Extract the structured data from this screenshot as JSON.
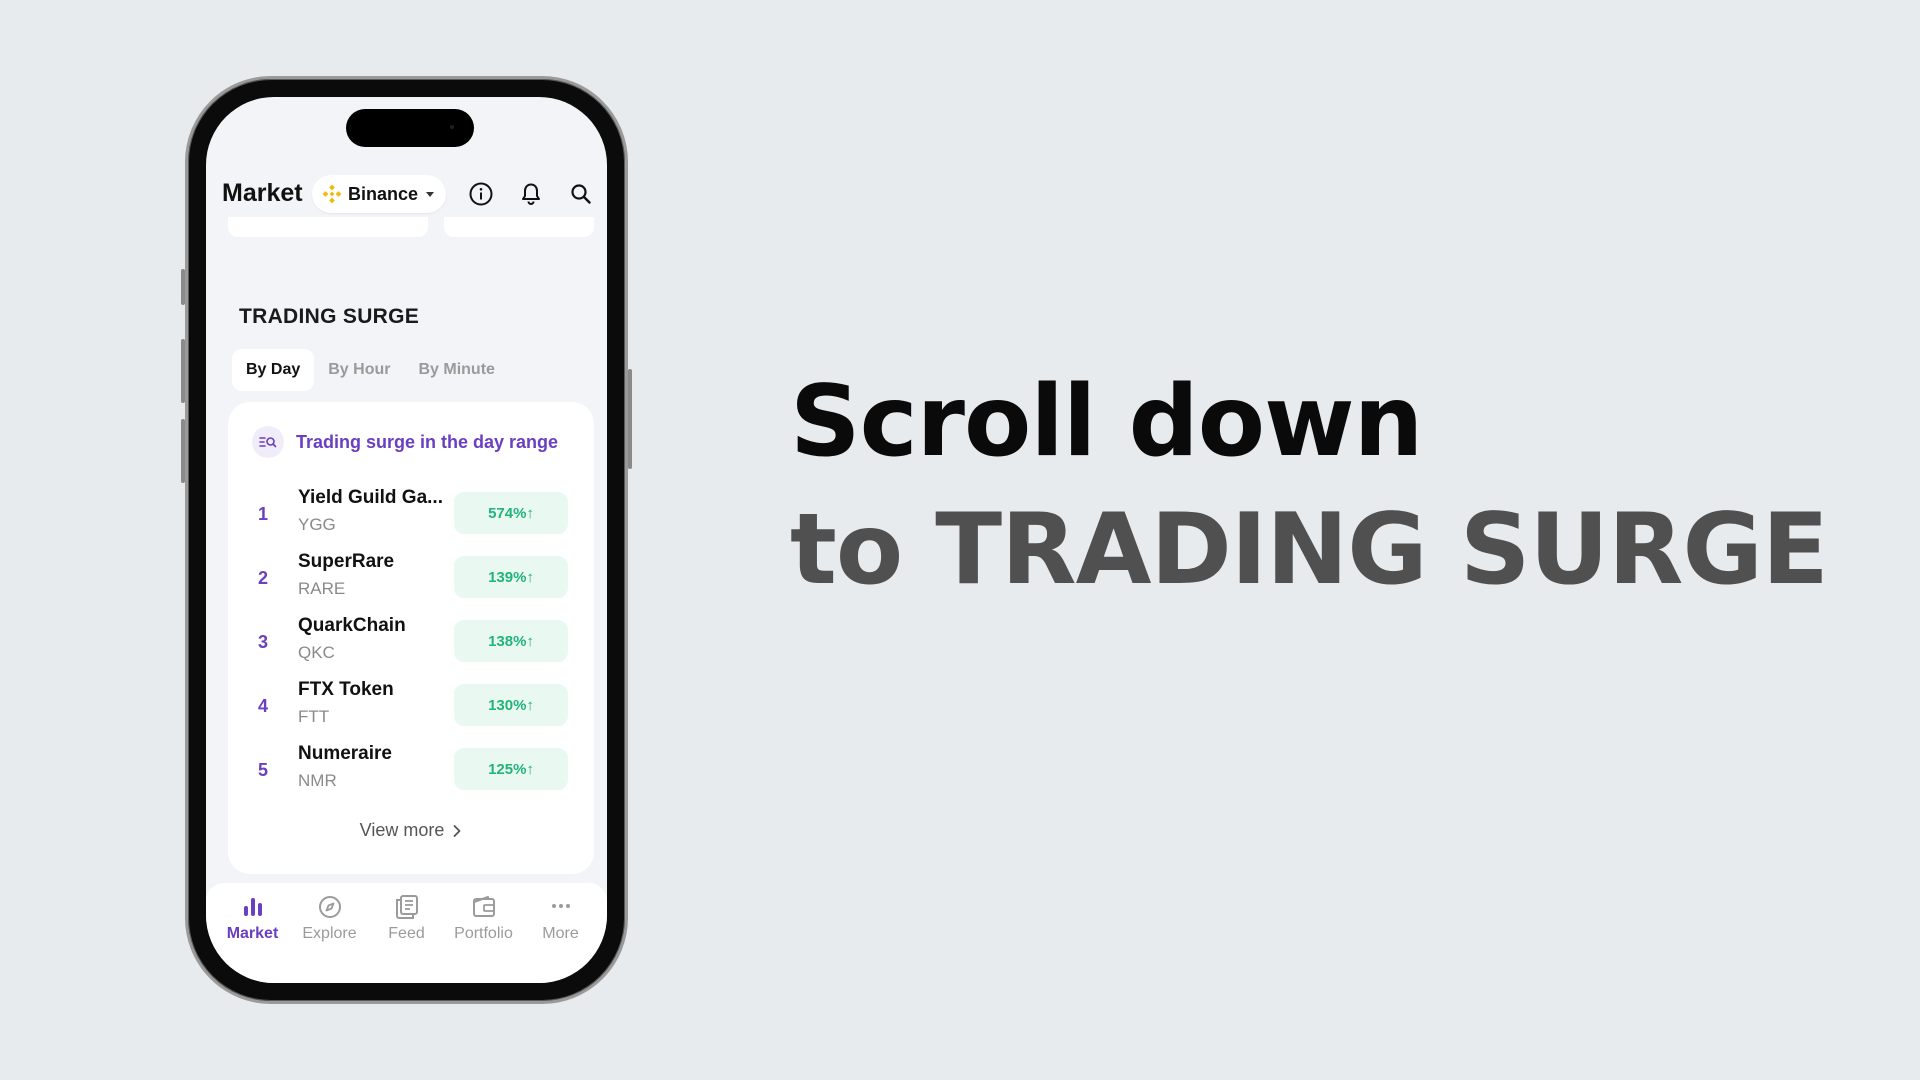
{
  "headline": {
    "line1": "Scroll down",
    "line2": "to TRADING SURGE"
  },
  "header": {
    "title": "Market",
    "exchange": "Binance",
    "icons": [
      "info-icon",
      "bell-icon",
      "search-icon"
    ]
  },
  "section": {
    "title": "TRADING SURGE",
    "tabs": [
      {
        "label": "By Day",
        "active": true
      },
      {
        "label": "By Hour",
        "active": false
      },
      {
        "label": "By Minute",
        "active": false
      }
    ],
    "card_title": "Trading surge in the day range",
    "rows": [
      {
        "rank": "1",
        "name": "Yield Guild Ga...",
        "symbol": "YGG",
        "change": "574%↑"
      },
      {
        "rank": "2",
        "name": "SuperRare",
        "symbol": "RARE",
        "change": "139%↑"
      },
      {
        "rank": "3",
        "name": "QuarkChain",
        "symbol": "QKC",
        "change": "138%↑"
      },
      {
        "rank": "4",
        "name": "FTX Token",
        "symbol": "FTT",
        "change": "130%↑"
      },
      {
        "rank": "5",
        "name": "Numeraire",
        "symbol": "NMR",
        "change": "125%↑"
      }
    ],
    "view_more": "View more"
  },
  "tabbar": {
    "items": [
      {
        "label": "Market",
        "icon": "bar-chart-icon",
        "active": true
      },
      {
        "label": "Explore",
        "icon": "compass-icon",
        "active": false
      },
      {
        "label": "Feed",
        "icon": "feed-icon",
        "active": false
      },
      {
        "label": "Portfolio",
        "icon": "wallet-icon",
        "active": false
      },
      {
        "label": "More",
        "icon": "more-dots-icon",
        "active": false
      }
    ]
  },
  "colors": {
    "accent": "#6a3fc0",
    "positive": "#22b47a",
    "positive_bg": "#e9f8f1",
    "binance": "#f0b90b",
    "background": "#e8ebee"
  }
}
